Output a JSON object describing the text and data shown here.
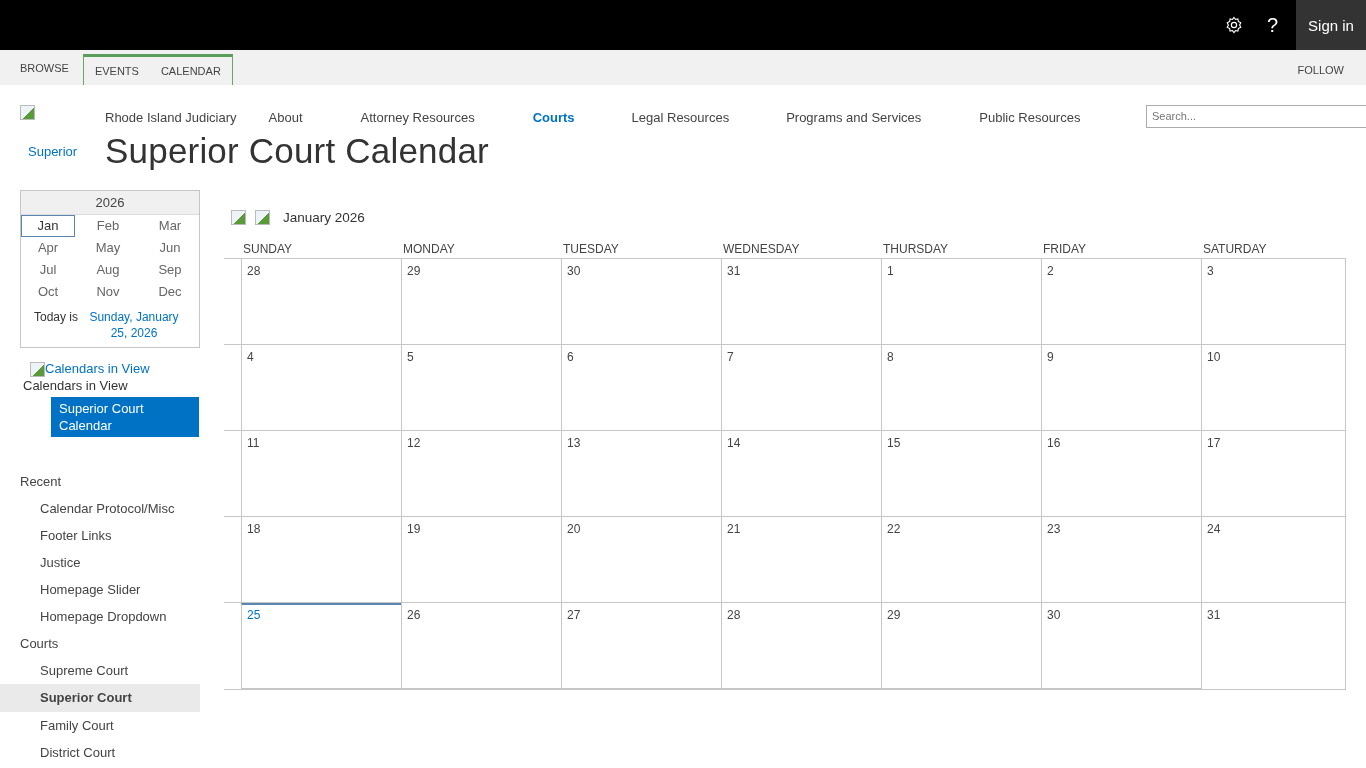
{
  "top_bar": {
    "sign_in": "Sign in",
    "help": "?"
  },
  "ribbon": {
    "tabs": [
      {
        "label": "BROWSE",
        "contextual": false
      },
      {
        "label": "EVENTS",
        "contextual": true
      },
      {
        "label": "CALENDAR",
        "contextual": true
      }
    ],
    "follow": "FOLLOW"
  },
  "header": {
    "site_link": "Superior",
    "title": "Superior Court Calendar",
    "search": {
      "placeholder": "Search..."
    },
    "nav": [
      {
        "label": "Rhode Island Judiciary",
        "selected": false
      },
      {
        "label": "About",
        "selected": false
      },
      {
        "label": "Attorney Resources",
        "selected": false
      },
      {
        "label": "Courts",
        "selected": true
      },
      {
        "label": "Legal Resources",
        "selected": false
      },
      {
        "label": "Programs and Services",
        "selected": false
      },
      {
        "label": "Public Resources",
        "selected": false
      }
    ]
  },
  "date_picker": {
    "year": "2026",
    "months": [
      {
        "label": "Jan",
        "selected": true
      },
      {
        "label": "Feb",
        "selected": false
      },
      {
        "label": "Mar",
        "selected": false
      },
      {
        "label": "Apr",
        "selected": false
      },
      {
        "label": "May",
        "selected": false
      },
      {
        "label": "Jun",
        "selected": false
      },
      {
        "label": "Jul",
        "selected": false
      },
      {
        "label": "Aug",
        "selected": false
      },
      {
        "label": "Sep",
        "selected": false
      },
      {
        "label": "Oct",
        "selected": false
      },
      {
        "label": "Nov",
        "selected": false
      },
      {
        "label": "Dec",
        "selected": false
      }
    ],
    "today_label": "Today is",
    "today_link": "Sunday, January 25, 2026"
  },
  "calendars_in_view": {
    "image_alt": "Calendars in View",
    "heading": "Calendars in View",
    "calendars": [
      "Superior Court Calendar"
    ]
  },
  "quick_launch": [
    {
      "heading": "Recent",
      "items": [
        {
          "label": "Calendar Protocol/Misc",
          "selected": false
        },
        {
          "label": "Footer Links",
          "selected": false
        },
        {
          "label": "Justice",
          "selected": false
        },
        {
          "label": "Homepage Slider",
          "selected": false
        },
        {
          "label": "Homepage Dropdown",
          "selected": false
        }
      ]
    },
    {
      "heading": "Courts",
      "items": [
        {
          "label": "Supreme Court",
          "selected": false
        },
        {
          "label": "Superior Court",
          "selected": true
        },
        {
          "label": "Family Court",
          "selected": false
        },
        {
          "label": "District Court",
          "selected": false
        }
      ]
    }
  ],
  "calendar": {
    "month_title": "January 2026",
    "weekdays": [
      "SUNDAY",
      "MONDAY",
      "TUESDAY",
      "WEDNESDAY",
      "THURSDAY",
      "FRIDAY",
      "SATURDAY"
    ],
    "weeks": [
      [
        {
          "day": "28",
          "today": false
        },
        {
          "day": "29",
          "today": false
        },
        {
          "day": "30",
          "today": false
        },
        {
          "day": "31",
          "today": false
        },
        {
          "day": "1",
          "today": false
        },
        {
          "day": "2",
          "today": false
        },
        {
          "day": "3",
          "today": false
        }
      ],
      [
        {
          "day": "4",
          "today": false
        },
        {
          "day": "5",
          "today": false
        },
        {
          "day": "6",
          "today": false
        },
        {
          "day": "7",
          "today": false
        },
        {
          "day": "8",
          "today": false
        },
        {
          "day": "9",
          "today": false
        },
        {
          "day": "10",
          "today": false
        }
      ],
      [
        {
          "day": "11",
          "today": false
        },
        {
          "day": "12",
          "today": false
        },
        {
          "day": "13",
          "today": false
        },
        {
          "day": "14",
          "today": false
        },
        {
          "day": "15",
          "today": false
        },
        {
          "day": "16",
          "today": false
        },
        {
          "day": "17",
          "today": false
        }
      ],
      [
        {
          "day": "18",
          "today": false
        },
        {
          "day": "19",
          "today": false
        },
        {
          "day": "20",
          "today": false
        },
        {
          "day": "21",
          "today": false
        },
        {
          "day": "22",
          "today": false
        },
        {
          "day": "23",
          "today": false
        },
        {
          "day": "24",
          "today": false
        }
      ],
      [
        {
          "day": "25",
          "today": true
        },
        {
          "day": "26",
          "today": false
        },
        {
          "day": "27",
          "today": false
        },
        {
          "day": "28",
          "today": false
        },
        {
          "day": "29",
          "today": false
        },
        {
          "day": "30",
          "today": false
        },
        {
          "day": "31",
          "today": false
        }
      ]
    ]
  }
}
